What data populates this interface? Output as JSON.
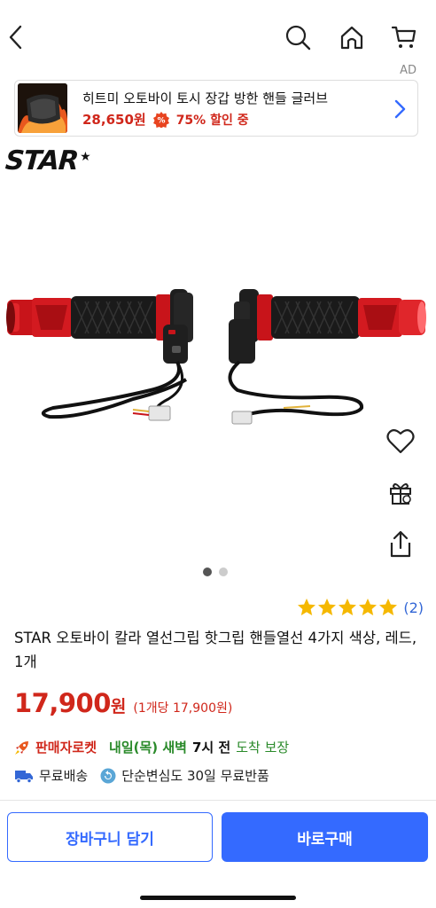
{
  "ad": {
    "label": "AD",
    "title": "히트미 오토바이 토시 장갑 방한 핸들 글러브",
    "price": "28,650원",
    "discount": "75% 할인 중"
  },
  "brand": {
    "name": "STAR",
    "mark": "★"
  },
  "carousel": {
    "total": 2,
    "current": 1
  },
  "rating": {
    "stars": 5,
    "count": "(2)"
  },
  "product": {
    "title": "STAR 오토바이 칼라 열선그립 핫그립 핸들열선 4가지 색상, 레드, 1개",
    "price": "17,900",
    "currency": "원",
    "unit_price": "(1개당 17,900원)"
  },
  "delivery": {
    "rocket_label": "판매자로켓",
    "eta_prefix": "내일(목) 새벽",
    "eta_time": "7시 전",
    "eta_suffix": "도착 보장"
  },
  "benefits": {
    "free_shipping": "무료배송",
    "free_return": "단순변심도 30일 무료반품"
  },
  "buttons": {
    "cart": "장바구니 담기",
    "buy": "바로구매"
  },
  "colors": {
    "accent_red": "#d0271b",
    "accent_blue": "#346aff",
    "star_yellow": "#f5b800",
    "eta_green": "#2a8a2a"
  }
}
